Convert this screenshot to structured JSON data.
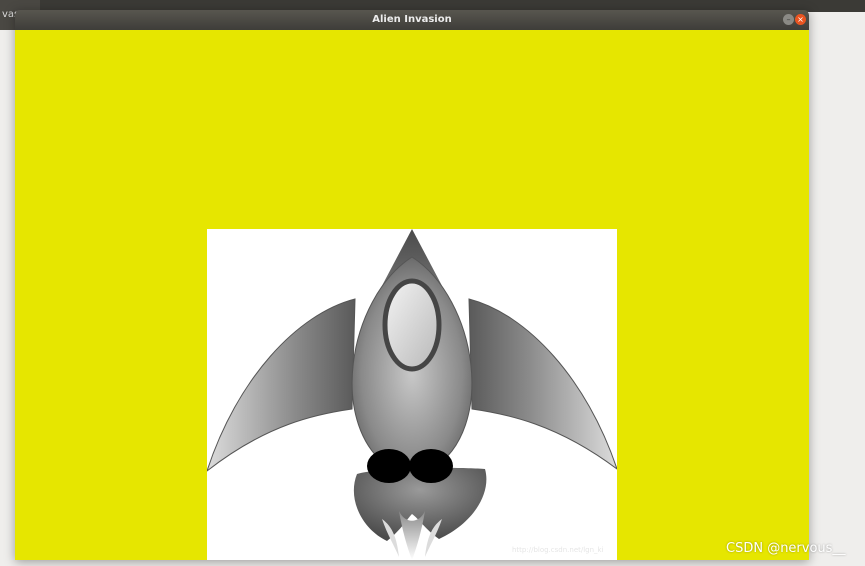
{
  "desktop": {
    "background_tab_label": "vas"
  },
  "window": {
    "title": "Alien Invasion",
    "minimize_symbol": "–",
    "close_symbol": "×"
  },
  "game": {
    "background_color": "#e6e600",
    "ship": {
      "image": "rocket-ship-icon",
      "image_background": "#ffffff",
      "watermark_text": "http://blog.csdn.net/lgn_ki"
    }
  },
  "overlay": {
    "watermark": "CSDN @nervous__"
  }
}
